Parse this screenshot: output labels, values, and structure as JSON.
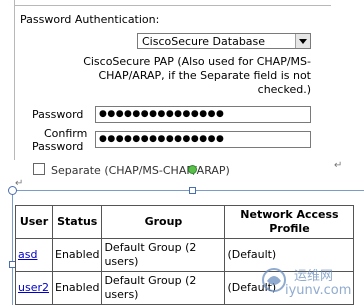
{
  "form": {
    "password_auth_label": "Password Authentication:",
    "db_select_value": "CiscoSecure Database",
    "pap_note_line1": "CiscoSecure PAP (Also used for CHAP/MS-",
    "pap_note_line2": "CHAP/ARAP, if the Separate field is not",
    "pap_note_line3": "checked.)",
    "password_label": "Password",
    "password_value": "●●●●●●●●●●●●●●●",
    "confirm_label_line1": "Confirm",
    "confirm_label_line2": "Password",
    "confirm_value": "●●●●●●●●●●●●●●●",
    "separate_label": "Separate (CHAP/MS-CHAP/ARAP)",
    "paragraph_mark": "↵"
  },
  "table": {
    "headers": [
      "User",
      "Status",
      "Group",
      "Network Access Profile"
    ],
    "rows": [
      {
        "user": "asd",
        "status": "Enabled",
        "group": "Default Group (2 users)",
        "profile": "(Default)"
      },
      {
        "user": "user2",
        "status": "Enabled",
        "group": "Default Group (2 users)",
        "profile": "(Default)"
      }
    ]
  },
  "watermark": {
    "line1": "运维网",
    "line2": "iyunv.com"
  },
  "colors": {
    "link": "#0000cc",
    "selection": "#7a9cc8",
    "rotate_handle": "#5bc04a"
  }
}
